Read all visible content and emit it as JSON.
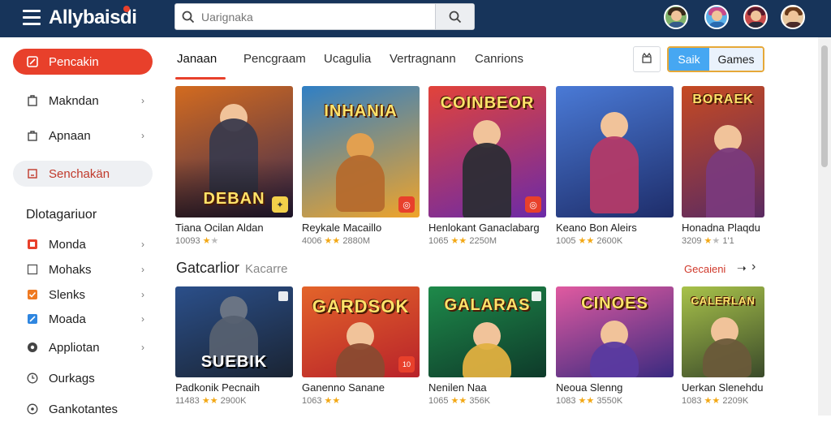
{
  "app": {
    "logo_text": "Allybaisdi"
  },
  "search": {
    "placeholder": "Uarignaka"
  },
  "sidebar": {
    "primary": {
      "label": "Pencakin"
    },
    "items": [
      {
        "label": "Makndan",
        "icon": "tag-icon"
      },
      {
        "label": "Apnaan",
        "icon": "bag-icon"
      },
      {
        "label": "Senchakän",
        "icon": "square-icon"
      }
    ],
    "heading": "Dlotagariuor",
    "categories": [
      {
        "label": "Monda",
        "icon": "grid-icon",
        "color": "#e8402b"
      },
      {
        "label": "Mohaks",
        "icon": "box-icon",
        "color": "#555555"
      },
      {
        "label": "Slenks",
        "icon": "check-icon",
        "color": "#ef7a22"
      },
      {
        "label": "Moada",
        "icon": "pen-icon",
        "color": "#2f86e0"
      },
      {
        "label": "Appliotan",
        "icon": "gear-icon",
        "color": "#444444"
      },
      {
        "label": "Ourkags",
        "icon": "clock-icon",
        "color": "#444444"
      },
      {
        "label": "Gankotantes",
        "icon": "circle-icon",
        "color": "#444444"
      }
    ]
  },
  "tabs": [
    {
      "label": "Janaan"
    },
    {
      "label": "Pencgraam"
    },
    {
      "label": "Ucagulia"
    },
    {
      "label": "Vertragnann"
    },
    {
      "label": "Canrions"
    }
  ],
  "toggle": {
    "left": "Saik",
    "right": "Games"
  },
  "row1": [
    {
      "name": "Tiana Ocilan Aldan",
      "rating": "10093",
      "stars": 2,
      "size": "",
      "art_title": "DEBAN",
      "bg1": "#d36b1f",
      "bg2": "#3b2a52",
      "hero": "#3a3a4c"
    },
    {
      "name": "Reykale Macaillo",
      "rating": "4006",
      "stars": 2,
      "size": "2880M",
      "art_title": "INHANIA",
      "bg1": "#2f7fc5",
      "bg2": "#f0a42a",
      "hero": "#b56a2d"
    },
    {
      "name": "Henlokant Ganaclabarg",
      "rating": "1065",
      "stars": 2,
      "size": "2250M",
      "art_title": "COINBEOR",
      "bg1": "#e2433a",
      "bg2": "#6b2aa8",
      "hero": "#2d2d35"
    },
    {
      "name": "Keano Bon Aleirs",
      "rating": "1005",
      "stars": 2,
      "size": "2600K",
      "art_title": "",
      "bg1": "#4a7ad6",
      "bg2": "#1e2d6a",
      "hero": "#b33a68"
    },
    {
      "name": "Honadna Plaqdu",
      "rating": "3209",
      "stars": 2,
      "size": "1'1",
      "art_title": "BORAEK",
      "bg1": "#c64a22",
      "bg2": "#5a2a62",
      "hero": "#7a3a7c"
    }
  ],
  "section": {
    "title": "Gatcarlior",
    "sub": "Kacarre",
    "see_all": "Gecaieni"
  },
  "row2": [
    {
      "name": "Padkonik Pecnaih",
      "rating": "11483",
      "stars": 2,
      "size": "2900K",
      "art_title": "SUEBIK",
      "bg1": "#2b4f8a",
      "bg2": "#1a2433",
      "hero": "#566070"
    },
    {
      "name": "Ganenno Sanane",
      "rating": "1063",
      "stars": 2,
      "size": "",
      "art_title": "GARDSOK",
      "bg1": "#e3642a",
      "bg2": "#b8222a",
      "hero": "#8a4a30"
    },
    {
      "name": "Nenilen Naa",
      "rating": "1065",
      "stars": 2,
      "size": "356K",
      "art_title": "GALARAS",
      "bg1": "#1e8a4a",
      "bg2": "#0e3a2a",
      "hero": "#e0b040"
    },
    {
      "name": "Neoua Slenng",
      "rating": "1083",
      "stars": 2,
      "size": "3550K",
      "art_title": "CINOES",
      "bg1": "#e05aa0",
      "bg2": "#3a2a80",
      "hero": "#5a3aa0"
    },
    {
      "name": "Uerkan Slenehdu",
      "rating": "1083",
      "stars": 2,
      "size": "2209K",
      "art_title": "CALERLAN",
      "bg1": "#a8c24a",
      "bg2": "#3a4a2a",
      "hero": "#6a5a3a"
    }
  ]
}
